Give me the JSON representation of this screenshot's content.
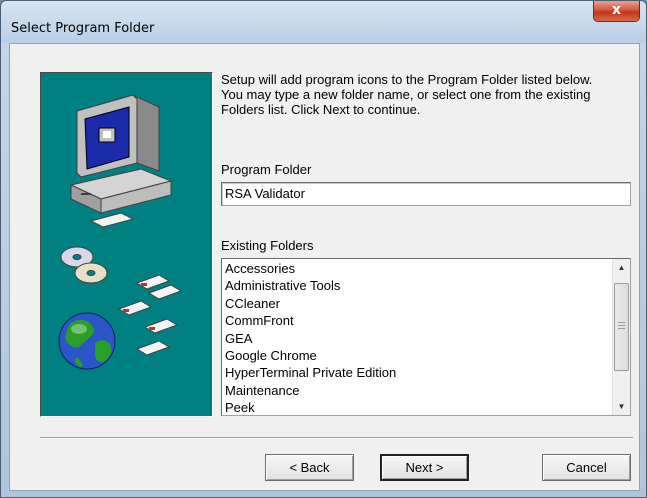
{
  "window": {
    "title": "Select Program Folder",
    "close_glyph": "x"
  },
  "intro_text": "Setup will add program icons to the Program Folder listed below.\nYou may type a new folder name, or select one from the existing\nFolders list. Click Next to continue.",
  "program_folder": {
    "label": "Program Folder",
    "value": "RSA Validator"
  },
  "existing_folders": {
    "label": "Existing Folders",
    "items": [
      "Accessories",
      "Administrative Tools",
      "CCleaner",
      "CommFront",
      "GEA",
      "Google Chrome",
      "HyperTerminal Private Edition",
      "Maintenance",
      "Peek"
    ]
  },
  "buttons": {
    "back": "< Back",
    "next": "Next >",
    "cancel": "Cancel"
  },
  "colors": {
    "art_background": "#008080",
    "dialog_background": "#f0f0f0",
    "close_button": "#c23518"
  }
}
